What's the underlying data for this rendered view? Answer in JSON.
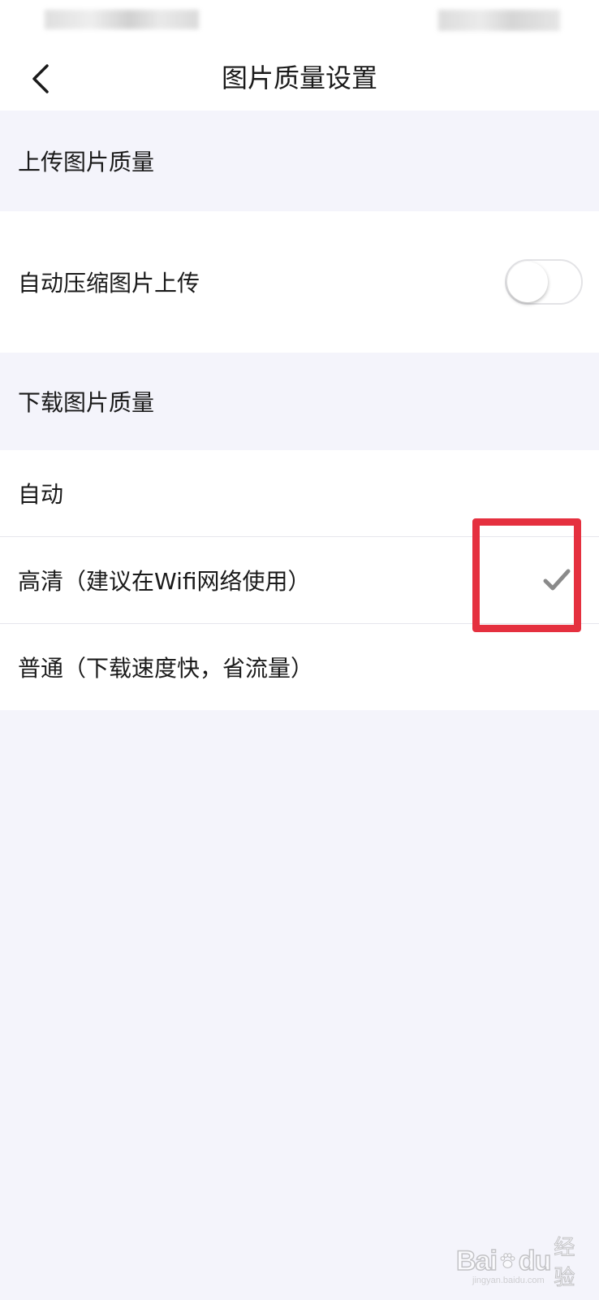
{
  "nav": {
    "title": "图片质量设置"
  },
  "upload_section": {
    "header": "上传图片质量",
    "auto_compress": {
      "label": "自动压缩图片上传",
      "enabled": false
    }
  },
  "download_section": {
    "header": "下载图片质量",
    "options": [
      {
        "label": "自动",
        "selected": false
      },
      {
        "label": "高清（建议在Wifi网络使用）",
        "selected": true
      },
      {
        "label": "普通（下载速度快，省流量）",
        "selected": false
      }
    ]
  },
  "colors": {
    "background": "#f4f4fb",
    "row_background": "#ffffff",
    "text": "#1a1a1a",
    "check": "#8a8a8a",
    "highlight": "#e5303f"
  },
  "watermark": {
    "logo": "Bai",
    "logo_suffix": "du",
    "text": "经验",
    "url": "jingyan.baidu.com"
  }
}
